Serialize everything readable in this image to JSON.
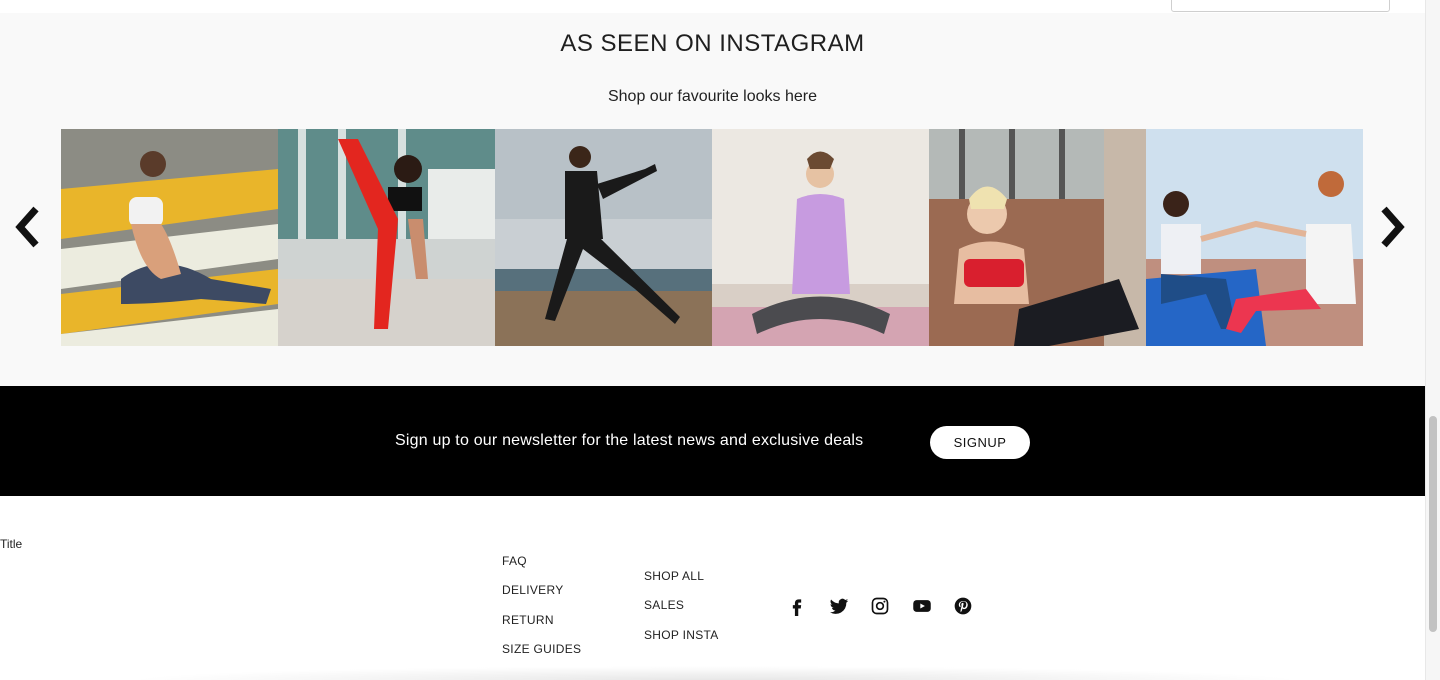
{
  "instagram": {
    "title": "AS SEEN ON INSTAGRAM",
    "subtitle": "Shop our favourite looks here",
    "images": [
      {
        "alt": "woman stretching on yellow striped crosswalk"
      },
      {
        "alt": "woman in red leggings doing high kick"
      },
      {
        "alt": "woman in black outfit posing on beach"
      },
      {
        "alt": "woman in lilac top sitting on yoga mat"
      },
      {
        "alt": "woman in red sports bra by brick wall"
      },
      {
        "alt": "two women exercising together on mats"
      }
    ],
    "prev_icon": "chevron-left-icon",
    "next_icon": "chevron-right-icon"
  },
  "newsletter": {
    "text": "Sign up to our newsletter for the latest news and exclusive deals",
    "button_label": "SIGNUP"
  },
  "footer": {
    "title": "Title",
    "col1": [
      "FAQ",
      "DELIVERY",
      "RETURN",
      "SIZE GUIDES"
    ],
    "col2": [
      "SHOP ALL",
      "SALES",
      "SHOP INSTA"
    ],
    "socials": [
      "facebook-icon",
      "twitter-icon",
      "instagram-icon",
      "youtube-icon",
      "pinterest-icon"
    ]
  },
  "colors": {
    "newsletter_bg": "#000000",
    "section_bg": "#f9f9f9",
    "button_bg": "#ffffff"
  }
}
